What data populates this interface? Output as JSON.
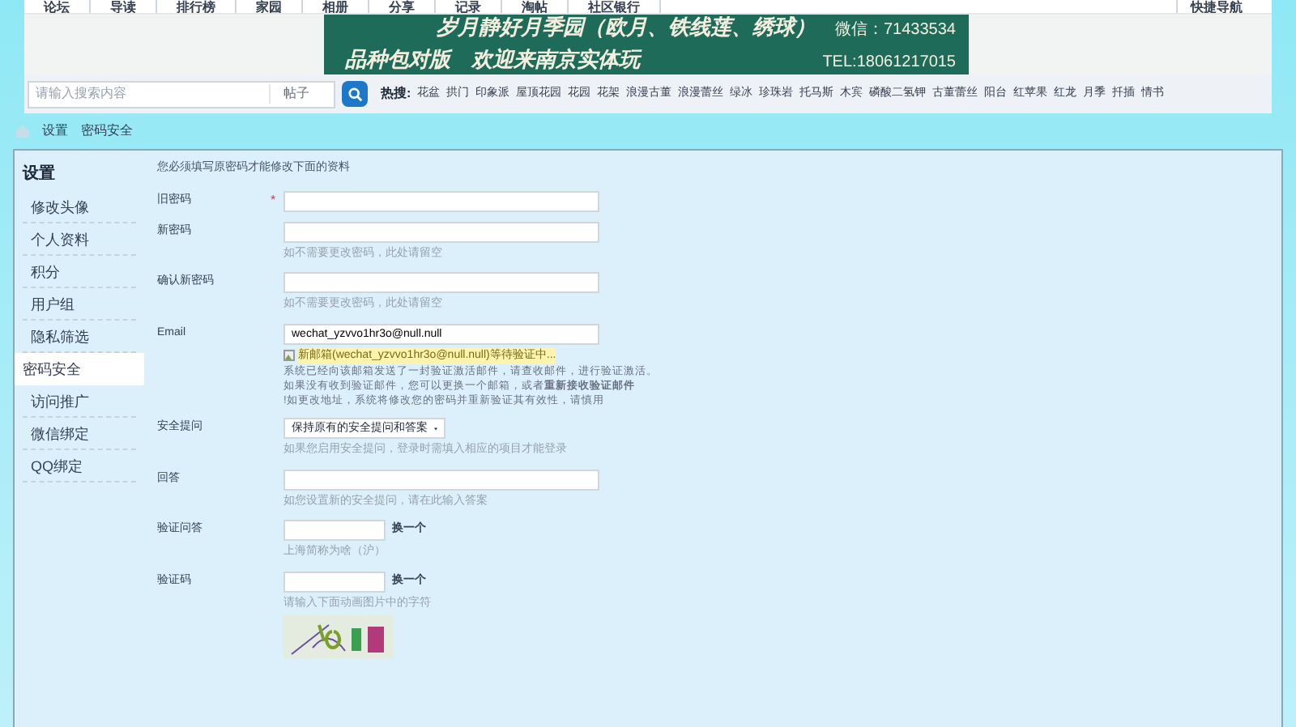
{
  "top_nav": {
    "items": [
      "论坛",
      "导读",
      "排行榜",
      "家园",
      "相册",
      "分享",
      "记录",
      "淘帖",
      "社区银行"
    ],
    "quick_nav": "快捷导航"
  },
  "banner": {
    "line1": "岁月静好月季园（欧月、铁线莲、绣球）",
    "line2": "品种包对版　欢迎来南京实体玩",
    "wechat": "微信：71433534",
    "tel": "TEL:18061217015"
  },
  "search": {
    "placeholder": "请输入搜索内容",
    "scope": "帖子",
    "hot_label": "热搜:",
    "hot": [
      "花盆",
      "拱门",
      "印象派",
      "屋顶花园",
      "花园",
      "花架",
      "浪漫古董",
      "浪漫蕾丝",
      "绿冰",
      "珍珠岩",
      "托马斯",
      "木宾",
      "磷酸二氢钾",
      "古董蕾丝",
      "阳台",
      "红苹果",
      "红龙",
      "月季",
      "扦插",
      "情书"
    ]
  },
  "breadcrumb": [
    "设置",
    "密码安全"
  ],
  "sidebar": {
    "title": "设置",
    "items": [
      {
        "label": "修改头像",
        "selected": false
      },
      {
        "label": "个人资料",
        "selected": false
      },
      {
        "label": "积分",
        "selected": false
      },
      {
        "label": "用户组",
        "selected": false
      },
      {
        "label": "隐私筛选",
        "selected": false
      },
      {
        "label": "密码安全",
        "selected": true
      },
      {
        "label": "访问推广",
        "selected": false
      },
      {
        "label": "微信绑定",
        "selected": false
      },
      {
        "label": "QQ绑定",
        "selected": false
      }
    ]
  },
  "form": {
    "intro": "您必须填写原密码才能修改下面的资料",
    "fields": [
      {
        "kind": "input",
        "label": "旧密码",
        "required_mark": "*"
      },
      {
        "kind": "input",
        "label": "新密码",
        "hint": "如不需要更改密码，此处请留空"
      },
      {
        "kind": "input",
        "label": "确认新密码",
        "hint": "如不需要更改密码，此处请留空"
      },
      {
        "kind": "email",
        "label": "Email",
        "value": "wechat_yzvvo1hr3o@null.null",
        "status": "新邮箱(wechat_yzvvo1hr3o@null.null)等待验证中...",
        "notes": [
          "系统已经向该邮箱发送了一封验证激活邮件，请查收邮件，进行验证激活。",
          "如果没有收到验证邮件，您可以更换一个邮箱，或者**重新接收验证邮件**",
          "!如更改地址，系统将修改您的密码并重新验证其有效性，请慎用"
        ]
      },
      {
        "kind": "select",
        "label": "安全提问",
        "value": "保持原有的安全提问和答案",
        "hint": "如果您启用安全提问，登录时需填入相应的项目才能登录"
      },
      {
        "kind": "input",
        "label": "回答",
        "hint": "如您设置新的安全提问，请在此输入答案"
      },
      {
        "kind": "short",
        "label": "验证问答",
        "action": "换一个",
        "hint": "上海简称为啥（沪）"
      },
      {
        "kind": "captcha",
        "label": "验证码",
        "action": "换一个",
        "hint": "请输入下面动画图片中的字符"
      }
    ]
  }
}
